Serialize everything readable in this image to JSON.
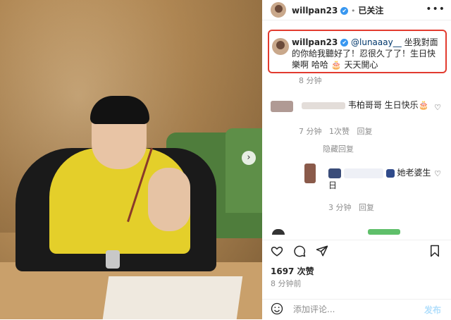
{
  "header": {
    "username": "willpan23",
    "verified_badge": "✔",
    "separator": "•",
    "follow_status": "已关注",
    "more_icon": "•••"
  },
  "caption": {
    "username": "willpan23",
    "mention": "@lunaaay__",
    "text": "坐我對面的你給我聽好了！忍很久了了！生日快樂啊 哈哈",
    "emoji": "🎂",
    "text_end": "天天開心",
    "time": "8 分钟"
  },
  "comments": [
    {
      "text": "韦柏哥哥 生日快乐🎂",
      "time": "7 分钟",
      "likes": "1次赞",
      "reply": "回复"
    }
  ],
  "hide_replies": "隐藏回复",
  "reply": {
    "text_a": "她老婆生日",
    "time": "3 分钟",
    "reply": "回复"
  },
  "actions": {
    "like_icon": "heart-icon",
    "comment_icon": "comment-icon",
    "share_icon": "share-icon",
    "save_icon": "bookmark-icon"
  },
  "likes_count": "1697 次赞",
  "posted_ago": "8 分钟前",
  "add_comment": {
    "placeholder": "添加评论...",
    "post_label": "发布"
  },
  "photo_next": "›",
  "colors": {
    "highlight_border": "#e23b2f",
    "link": "#00376b",
    "verified": "#3897f0"
  }
}
